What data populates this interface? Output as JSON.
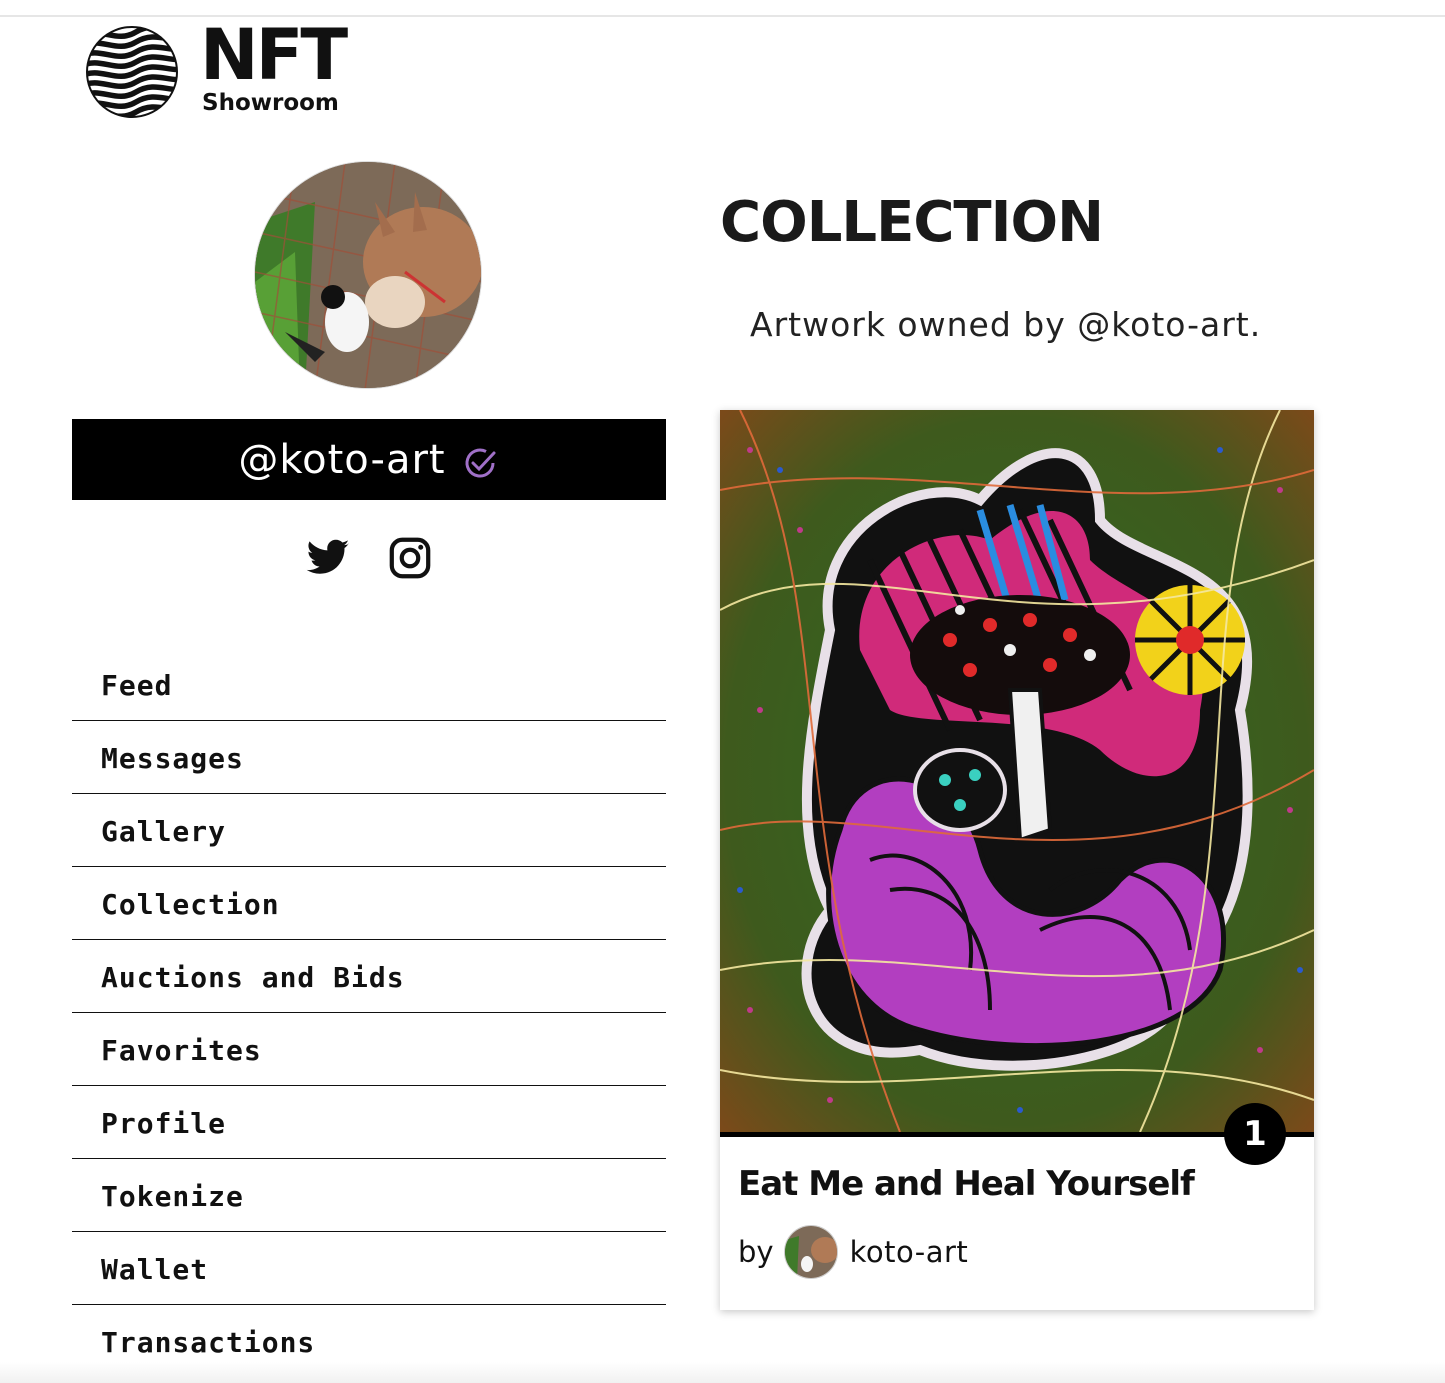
{
  "brand": {
    "word": "NFT",
    "sub": "Showroom",
    "logo_icon": "wavy-globe-icon"
  },
  "profile": {
    "username": "@koto-art",
    "verified_icon": "verified-check-icon",
    "verified_color": "#a070c8",
    "avatar": "donkey-and-cat-photo",
    "social": [
      "twitter-icon",
      "instagram-icon"
    ]
  },
  "nav": {
    "items": [
      {
        "label": "Feed"
      },
      {
        "label": "Messages"
      },
      {
        "label": "Gallery"
      },
      {
        "label": "Collection"
      },
      {
        "label": "Auctions and Bids"
      },
      {
        "label": "Favorites"
      },
      {
        "label": "Profile"
      },
      {
        "label": "Tokenize"
      },
      {
        "label": "Wallet"
      },
      {
        "label": "Transactions"
      }
    ]
  },
  "main": {
    "title": "COLLECTION",
    "subtitle": "Artwork owned by @koto-art."
  },
  "card": {
    "edition": "1",
    "title": "Eat Me and Heal Yourself",
    "by_label": "by",
    "creator": "koto-art",
    "artwork": "psychedelic-mushroom-artwork"
  }
}
